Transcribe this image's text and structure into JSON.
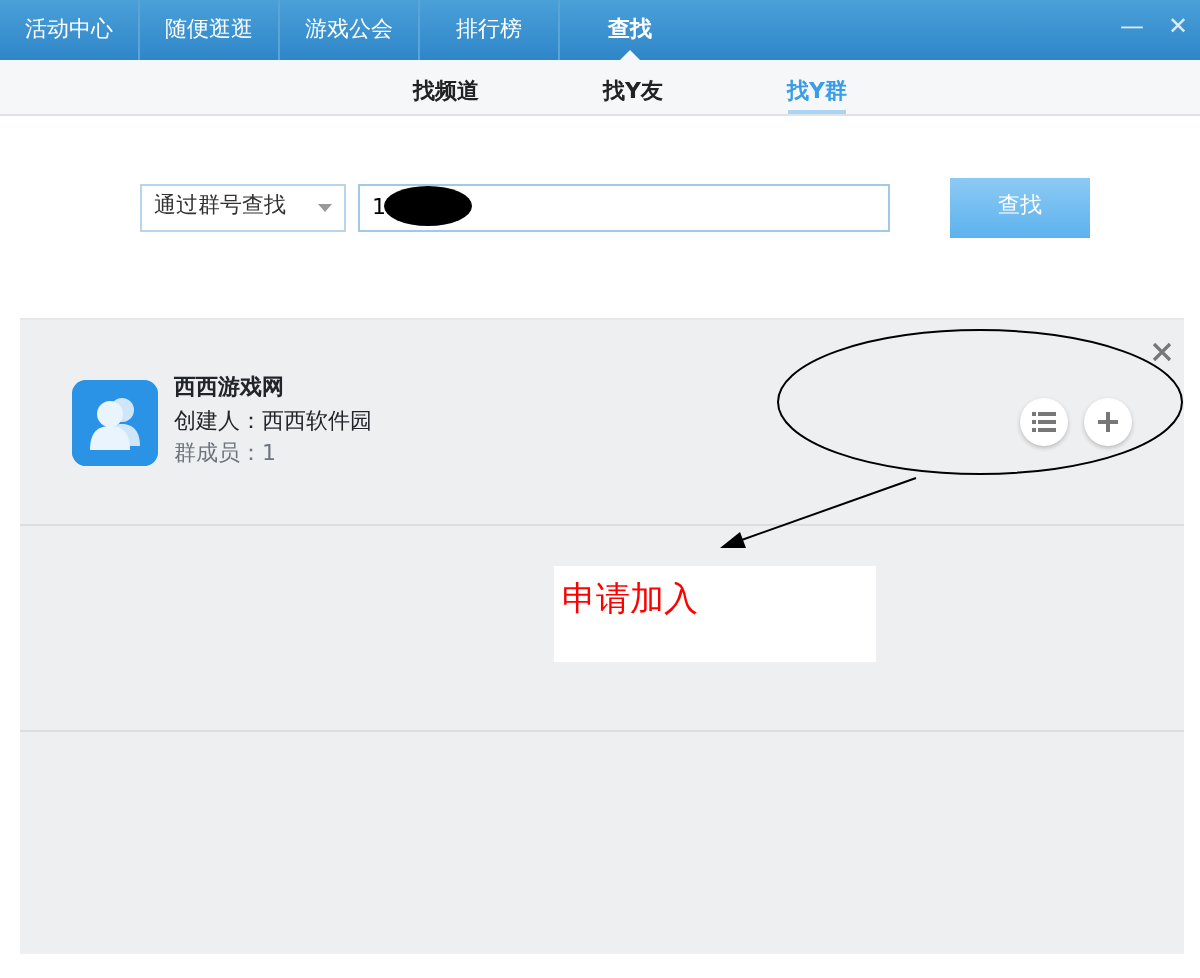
{
  "top_tabs": [
    {
      "label": "活动中心",
      "selected": false
    },
    {
      "label": "随便逛逛",
      "selected": false
    },
    {
      "label": "游戏公会",
      "selected": false
    },
    {
      "label": "排行榜",
      "selected": false
    },
    {
      "label": "查找",
      "selected": true
    }
  ],
  "window_controls": {
    "minimize": "—",
    "close": "✕"
  },
  "sub_tabs": [
    {
      "label": "找频道",
      "selected": false
    },
    {
      "label": "找Y友",
      "selected": false
    },
    {
      "label": "找Y群",
      "selected": true
    }
  ],
  "search": {
    "mode": "通过群号查找",
    "value": "1",
    "button": "查找"
  },
  "results": [
    {
      "name": "西西游戏网",
      "creator": "创建人：西西软件园",
      "members": "群成员：1"
    }
  ],
  "annotation": {
    "text": "申请加入"
  }
}
